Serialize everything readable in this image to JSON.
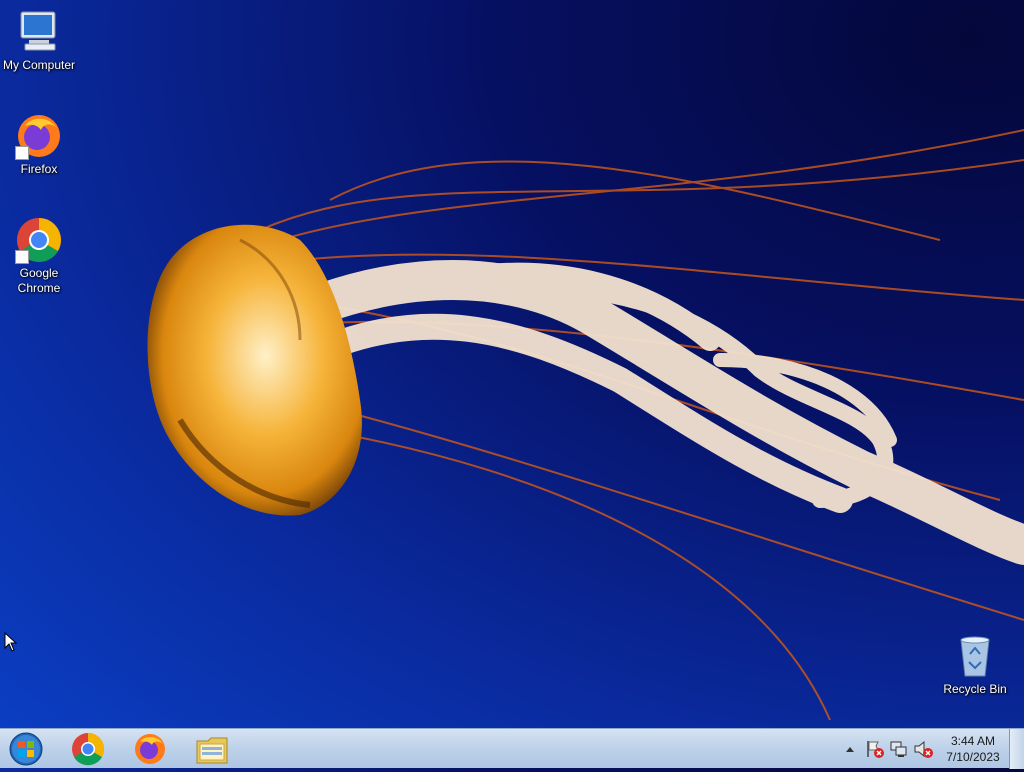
{
  "desktop": {
    "icons": [
      {
        "label": "My Computer",
        "icon": "computer-icon"
      },
      {
        "label": "Firefox",
        "icon": "firefox-icon"
      },
      {
        "label": "Google\nChrome",
        "icon": "chrome-icon"
      },
      {
        "label": "Recycle Bin",
        "icon": "recycle-bin-icon"
      }
    ]
  },
  "taskbar": {
    "start_icon": "windows-start-icon",
    "pinned": [
      {
        "icon": "chrome-icon"
      },
      {
        "icon": "firefox-icon"
      },
      {
        "icon": "file-explorer-icon"
      }
    ],
    "tray_icons": [
      "show-hidden-icons-chevron",
      "action-center-flag-icon",
      "network-icon",
      "volume-muted-icon"
    ],
    "clock": {
      "time": "3:44 AM",
      "date": "7/10/2023"
    }
  }
}
